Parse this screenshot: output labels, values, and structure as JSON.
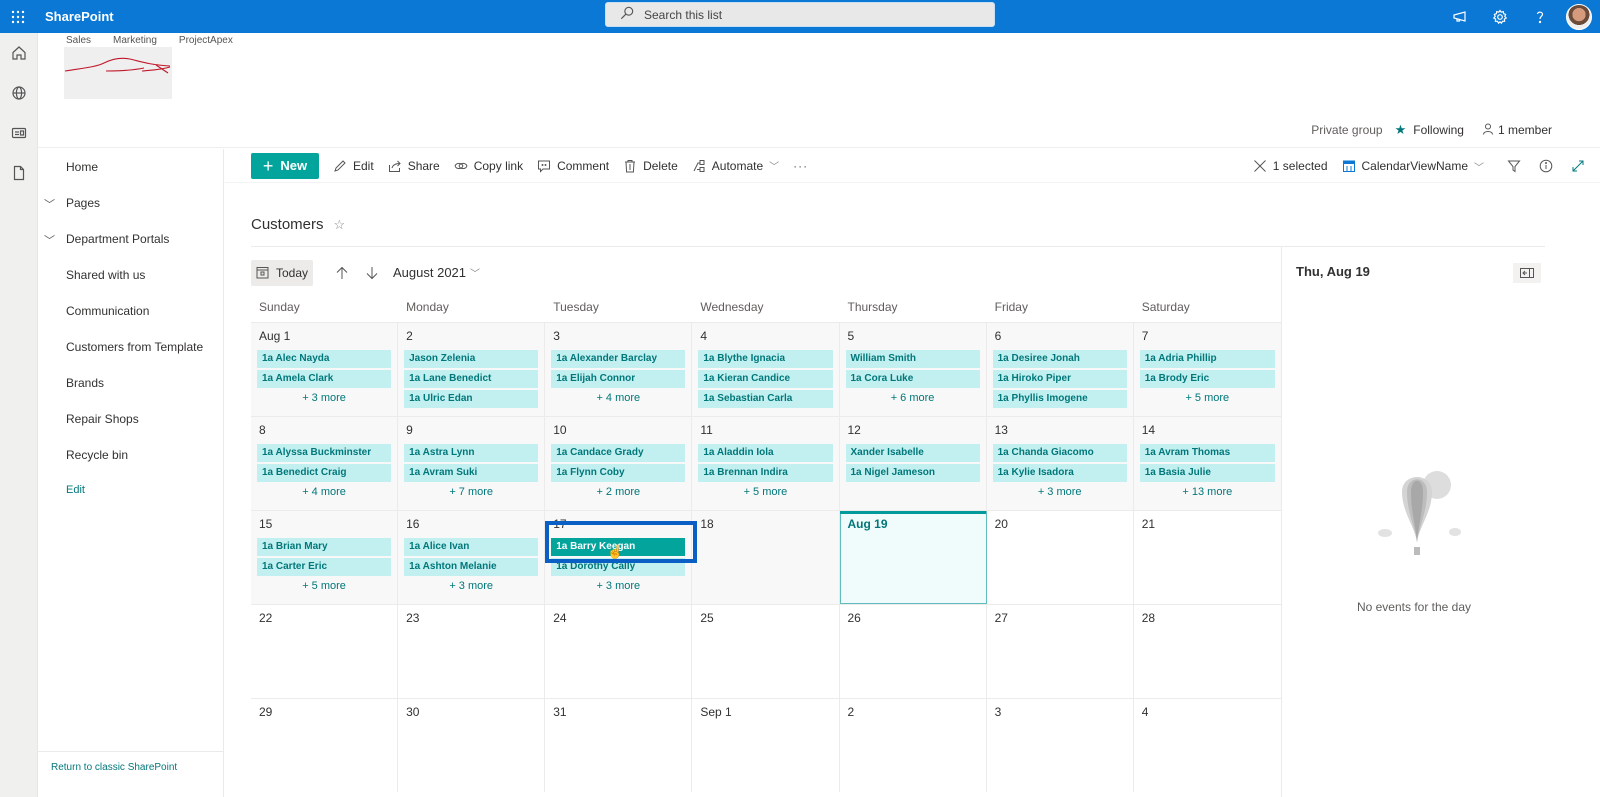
{
  "suitebar": {
    "brand": "SharePoint",
    "search_placeholder": "Search this list",
    "icons": [
      "waffle-icon",
      "megaphone-icon",
      "gear-icon",
      "help-icon",
      "avatar"
    ]
  },
  "appbar": {
    "icons": [
      "home-icon",
      "globe-icon",
      "news-icon",
      "document-icon"
    ]
  },
  "site": {
    "hubnav": [
      "Sales",
      "Marketing",
      "ProjectApex"
    ],
    "group_type": "Private group",
    "following": "Following",
    "members": "1 member"
  },
  "leftnav": {
    "items": [
      {
        "label": "Home",
        "expandable": false
      },
      {
        "label": "Pages",
        "expandable": true
      },
      {
        "label": "Department Portals",
        "expandable": true
      },
      {
        "label": "Shared with us",
        "expandable": false
      },
      {
        "label": "Communication",
        "expandable": false
      },
      {
        "label": "Customers from Template",
        "expandable": false
      },
      {
        "label": "Brands",
        "expandable": false
      },
      {
        "label": "Repair Shops",
        "expandable": false
      },
      {
        "label": "Recycle bin",
        "expandable": false
      }
    ],
    "edit": "Edit",
    "return_classic": "Return to classic SharePoint"
  },
  "commandbar": {
    "new": "New",
    "edit": "Edit",
    "share": "Share",
    "copy_link": "Copy link",
    "comment": "Comment",
    "delete": "Delete",
    "automate": "Automate",
    "more": "···",
    "selected": "1 selected",
    "view_name": "CalendarViewName"
  },
  "list": {
    "title": "Customers"
  },
  "calendar": {
    "today_label": "Today",
    "month": "August 2021",
    "weekdays": [
      "Sunday",
      "Monday",
      "Tuesday",
      "Wednesday",
      "Thursday",
      "Friday",
      "Saturday"
    ],
    "weeks": [
      [
        {
          "label": "Aug 1",
          "events": [
            "1a Alec Nayda",
            "1a Amela Clark"
          ],
          "more": "+ 3 more"
        },
        {
          "label": "2",
          "events": [
            "Jason Zelenia",
            "1a Lane Benedict",
            "1a Ulric Edan"
          ],
          "more": ""
        },
        {
          "label": "3",
          "events": [
            "1a Alexander Barclay",
            "1a Elijah Connor"
          ],
          "more": "+ 4 more"
        },
        {
          "label": "4",
          "events": [
            "1a Blythe Ignacia",
            "1a Kieran Candice",
            "1a Sebastian Carla"
          ],
          "more": ""
        },
        {
          "label": "5",
          "events": [
            "William Smith",
            "1a Cora Luke"
          ],
          "more": "+ 6 more"
        },
        {
          "label": "6",
          "events": [
            "1a Desiree Jonah",
            "1a Hiroko Piper",
            "1a Phyllis Imogene"
          ],
          "more": ""
        },
        {
          "label": "7",
          "events": [
            "1a Adria Phillip",
            "1a Brody Eric"
          ],
          "more": "+ 5 more"
        }
      ],
      [
        {
          "label": "8",
          "events": [
            "1a Alyssa Buckminster",
            "1a Benedict Craig"
          ],
          "more": "+ 4 more"
        },
        {
          "label": "9",
          "events": [
            "1a Astra Lynn",
            "1a Avram Suki"
          ],
          "more": "+ 7 more"
        },
        {
          "label": "10",
          "events": [
            "1a Candace Grady",
            "1a Flynn Coby"
          ],
          "more": "+ 2 more"
        },
        {
          "label": "11",
          "events": [
            "1a Aladdin Iola",
            "1a Brennan Indira"
          ],
          "more": "+ 5 more"
        },
        {
          "label": "12",
          "events": [
            "Xander Isabelle",
            "1a Nigel Jameson"
          ],
          "more": ""
        },
        {
          "label": "13",
          "events": [
            "1a Chanda Giacomo",
            "1a Kylie Isadora"
          ],
          "more": "+ 3 more"
        },
        {
          "label": "14",
          "events": [
            "1a Avram Thomas",
            "1a Basia Julie"
          ],
          "more": "+ 13 more"
        }
      ],
      [
        {
          "label": "15",
          "events": [
            "1a Brian Mary",
            "1a Carter Eric"
          ],
          "more": "+ 5 more"
        },
        {
          "label": "16",
          "events": [
            "1a Alice Ivan",
            "1a Ashton Melanie"
          ],
          "more": "+ 3 more"
        },
        {
          "label": "17",
          "events": [
            "1a Barry Keegan",
            "1a Dorothy Cally"
          ],
          "more": "+ 3 more",
          "selected_event": 0
        },
        {
          "label": "18",
          "events": [],
          "more": ""
        },
        {
          "label": "Aug 19",
          "events": [],
          "more": "",
          "today": true
        },
        {
          "label": "20",
          "events": [],
          "more": ""
        },
        {
          "label": "21",
          "events": [],
          "more": ""
        }
      ],
      [
        {
          "label": "22",
          "events": [],
          "more": ""
        },
        {
          "label": "23",
          "events": [],
          "more": ""
        },
        {
          "label": "24",
          "events": [],
          "more": ""
        },
        {
          "label": "25",
          "events": [],
          "more": ""
        },
        {
          "label": "26",
          "events": [],
          "more": ""
        },
        {
          "label": "27",
          "events": [],
          "more": ""
        },
        {
          "label": "28",
          "events": [],
          "more": ""
        }
      ],
      [
        {
          "label": "29",
          "events": [],
          "more": ""
        },
        {
          "label": "30",
          "events": [],
          "more": ""
        },
        {
          "label": "31",
          "events": [],
          "more": ""
        },
        {
          "label": "Sep 1",
          "events": [],
          "more": ""
        },
        {
          "label": "2",
          "events": [],
          "more": ""
        },
        {
          "label": "3",
          "events": [],
          "more": ""
        },
        {
          "label": "4",
          "events": [],
          "more": ""
        }
      ]
    ]
  },
  "daypanel": {
    "title": "Thu, Aug 19",
    "empty_message": "No events for the day"
  },
  "colors": {
    "suitebar": "#0a78d4",
    "accent": "#03a49c",
    "event_bg": "#c2f0f0",
    "event_text": "#01777a",
    "highlight_box": "#0a5fc4"
  }
}
